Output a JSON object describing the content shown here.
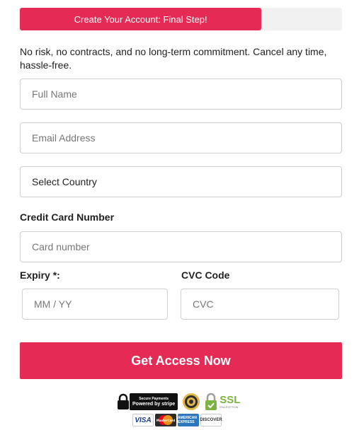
{
  "progress": {
    "label": "Create Your Account: Final Step!",
    "fraction": 0.75
  },
  "intro": "No risk, no contracts, and no long-term commitment. Cancel any time, hassle-free.",
  "fields": {
    "full_name": {
      "placeholder": "Full Name"
    },
    "email": {
      "placeholder": "Email Address"
    },
    "country": {
      "value": "Select Country"
    },
    "card_label": "Credit Card Number",
    "card": {
      "placeholder": "Card number"
    },
    "expiry_label": "Expiry *:",
    "expiry": {
      "placeholder": "MM / YY"
    },
    "cvc_label": "CVC Code",
    "cvc": {
      "placeholder": "CVC"
    }
  },
  "cta": {
    "label": "Get Access Now"
  },
  "badges": {
    "stripe_top": "Secure Payments",
    "stripe_bottom": "Powered by stripe",
    "ssl_text": "SSL",
    "ssl_sub": "ENCRYPTION",
    "cards": [
      "VISA",
      "MasterCard",
      "AMERICAN EXPRESS",
      "DISCOVER"
    ]
  },
  "colors": {
    "accent": "#e52b55",
    "track": "#f1f1f1",
    "ssl_green": "#7cb342"
  }
}
